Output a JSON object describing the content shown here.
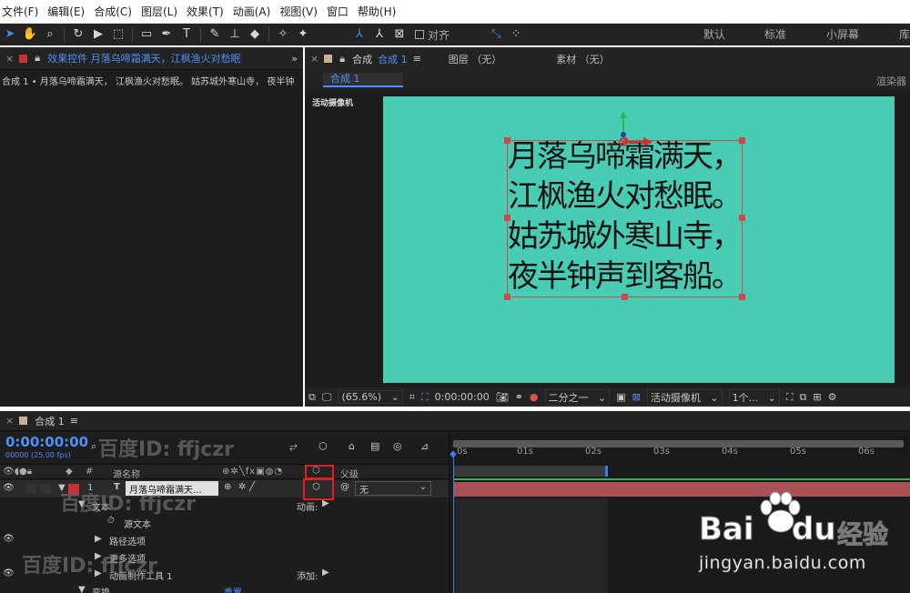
{
  "menu": [
    "文件(F)",
    "编辑(E)",
    "合成(C)",
    "图层(L)",
    "效果(T)",
    "动画(A)",
    "视图(V)",
    "窗口",
    "帮助(H)"
  ],
  "toolbar": {
    "align_label": "对齐",
    "workspaces": [
      "默认",
      "标准",
      "小屏幕",
      "库"
    ]
  },
  "effects_panel": {
    "tab_title": "效果控件 月落乌啼霜满天，江枫渔火对愁眠",
    "breadcrumb": "合成 1 • 月落乌啼霜满天， 江枫渔火对愁眠。 姑苏城外寒山寺， 夜半钟"
  },
  "comp_panel": {
    "tab_prefix": "合成",
    "tab_name": "合成 1",
    "layer_tab": "图层 （无）",
    "footage_tab": "素材 （无）",
    "comp_button": "合成 1",
    "renderer": "渲染器",
    "camera_label": "活动摄像机"
  },
  "poem": [
    "月落乌啼霜满天，",
    "江枫渔火对愁眠。",
    "姑苏城外寒山寺，",
    "夜半钟声到客船。"
  ],
  "viewbar": {
    "zoom": "(65.6%)",
    "time": "0:00:00:00",
    "resolution": "二分之一",
    "camera": "活动摄像机",
    "views": "1个..."
  },
  "timeline": {
    "tab": "合成 1",
    "timecode": "0:00:00:00",
    "fps": "00000 (25.00 fps)",
    "col_source": "源名称",
    "col_parent": "父级",
    "layer_num": "1",
    "layer_name": "月落乌啼霜满天...",
    "parent_value": "无",
    "rows": [
      "文本",
      "源文本",
      "路径选项",
      "更多选项",
      "动画制作工具 1",
      "变换"
    ],
    "animate_label": "动画:",
    "add_label": "添加:",
    "reset_label": "重置",
    "ruler": [
      "0s",
      "01s",
      "02s",
      "03s",
      "04s",
      "05s",
      "06s"
    ]
  },
  "watermarks": [
    "百度ID: ffjczr",
    "百度ID: ffjczr",
    "百度ID: ffjczr"
  ],
  "baidu": {
    "logo_bai": "Bai",
    "logo_du": "du",
    "logo_jy": "经验",
    "url": "jingyan.baidu.com"
  }
}
